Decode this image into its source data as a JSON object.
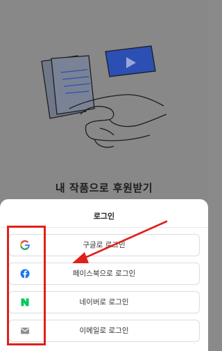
{
  "headline": "내 작품으로 후원받기",
  "sheet": {
    "title": "로그인",
    "buttons": [
      {
        "label": "구글로 로그인",
        "icon": "google-icon"
      },
      {
        "label": "페이스북으로 로그인",
        "icon": "facebook-icon"
      },
      {
        "label": "네이버로 로그인",
        "icon": "naver-icon"
      },
      {
        "label": "이메일로 로그인",
        "icon": "mail-icon"
      }
    ]
  },
  "colors": {
    "annotation": "#e0201a",
    "facebook": "#1877f2",
    "naver": "#03c75a",
    "video_card": "#2c4fb4"
  }
}
